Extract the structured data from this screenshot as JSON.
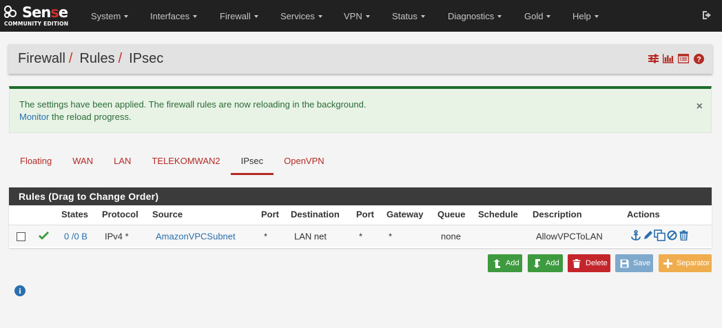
{
  "brand": {
    "name_a": "Sen",
    "name_b": "s",
    "name_c": "e",
    "subtitle": "COMMUNITY EDITION"
  },
  "nav": [
    {
      "label": "System",
      "key": "system"
    },
    {
      "label": "Interfaces",
      "key": "interfaces"
    },
    {
      "label": "Firewall",
      "key": "firewall"
    },
    {
      "label": "Services",
      "key": "services"
    },
    {
      "label": "VPN",
      "key": "vpn"
    },
    {
      "label": "Status",
      "key": "status"
    },
    {
      "label": "Diagnostics",
      "key": "diagnostics"
    },
    {
      "label": "Gold",
      "key": "gold"
    },
    {
      "label": "Help",
      "key": "help"
    }
  ],
  "breadcrumb": [
    "Firewall",
    "Rules",
    "IPsec"
  ],
  "alert": {
    "message": "The settings have been applied. The firewall rules are now reloading in the background.",
    "link": "Monitor",
    "message_tail": " the reload progress.",
    "close": "×"
  },
  "tabs": [
    "Floating",
    "WAN",
    "LAN",
    "TELEKOMWAN2",
    "IPsec",
    "OpenVPN"
  ],
  "active_tab": "IPsec",
  "rules": {
    "heading": "Rules (Drag to Change Order)",
    "columns": [
      "States",
      "Protocol",
      "Source",
      "Port",
      "Destination",
      "Port",
      "Gateway",
      "Queue",
      "Schedule",
      "Description",
      "Actions"
    ],
    "rows": [
      {
        "states": "0 /0 B",
        "protocol": "IPv4 *",
        "source": "AmazonVPCSubnet",
        "src_port": "*",
        "destination": "LAN net",
        "dst_port": "*",
        "gateway": "*",
        "queue": "none",
        "schedule": "",
        "description": "AllowVPCToLAN"
      }
    ]
  },
  "buttons": {
    "add_top": "Add",
    "add_bottom": "Add",
    "delete": "Delete",
    "save": "Save",
    "separator": "Separator"
  },
  "colors": {
    "accent_red": "#b52a24",
    "success_green": "#3e9a3f",
    "danger_red": "#c4252b",
    "info_blue": "#7ea9cc",
    "warning_orange": "#f0ad4e",
    "link_blue": "#2a6fad"
  }
}
